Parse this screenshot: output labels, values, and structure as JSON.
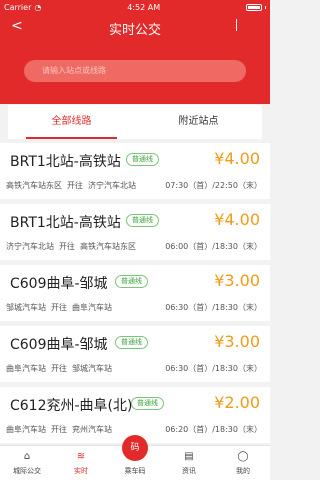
{
  "status": {
    "carrier": "Carrier",
    "time": "4:52 AM",
    "battery": "battery-full"
  },
  "header": {
    "back": "<",
    "title": "实时公交"
  },
  "search": {
    "placeholder": "请输入站点或线路"
  },
  "tabs": [
    {
      "label": "全部线路",
      "active": true
    },
    {
      "label": "附近站点",
      "active": false
    }
  ],
  "routes": [
    {
      "name": "BRT1北站-高铁站",
      "badge": "普通线",
      "price": "¥4.00",
      "from": "高铁汽车站东区",
      "dir": "开往",
      "to": "济宁汽车北站",
      "time": "07:30（首）/22:50（末）"
    },
    {
      "name": "BRT1北站-高铁站",
      "badge": "普通线",
      "price": "¥4.00",
      "from": "济宁汽车北站",
      "dir": "开往",
      "to": "高铁汽车站东区",
      "time": "06:00（首）/18:30（末）"
    },
    {
      "name": "C609曲阜-邹城",
      "badge": "普通线",
      "price": "¥3.00",
      "from": "邹城汽车站",
      "dir": "开往",
      "to": "曲阜汽车站",
      "time": "06:30（首）/18:30（末）"
    },
    {
      "name": "C609曲阜-邹城",
      "badge": "普通线",
      "price": "¥3.00",
      "from": "曲阜汽车站",
      "dir": "开往",
      "to": "邹城汽车站",
      "time": "06:30（首）/18:30（末）"
    },
    {
      "name": "C612兖州-曲阜(北)",
      "badge": "普通线",
      "price": "¥2.00",
      "from": "曲阜汽车站",
      "dir": "开往",
      "to": "兖州汽车站",
      "time": "06:20（首）/18:30（末）"
    }
  ],
  "nav": [
    {
      "label": "城际公交",
      "icon": "home-icon",
      "active": false
    },
    {
      "label": "实时",
      "icon": "realtime-icon",
      "active": true
    },
    {
      "label": "乘车码",
      "icon": "qr-icon",
      "active": false,
      "center": "码"
    },
    {
      "label": "资讯",
      "icon": "news-icon",
      "active": false
    },
    {
      "label": "我的",
      "icon": "user-icon",
      "active": false
    }
  ]
}
